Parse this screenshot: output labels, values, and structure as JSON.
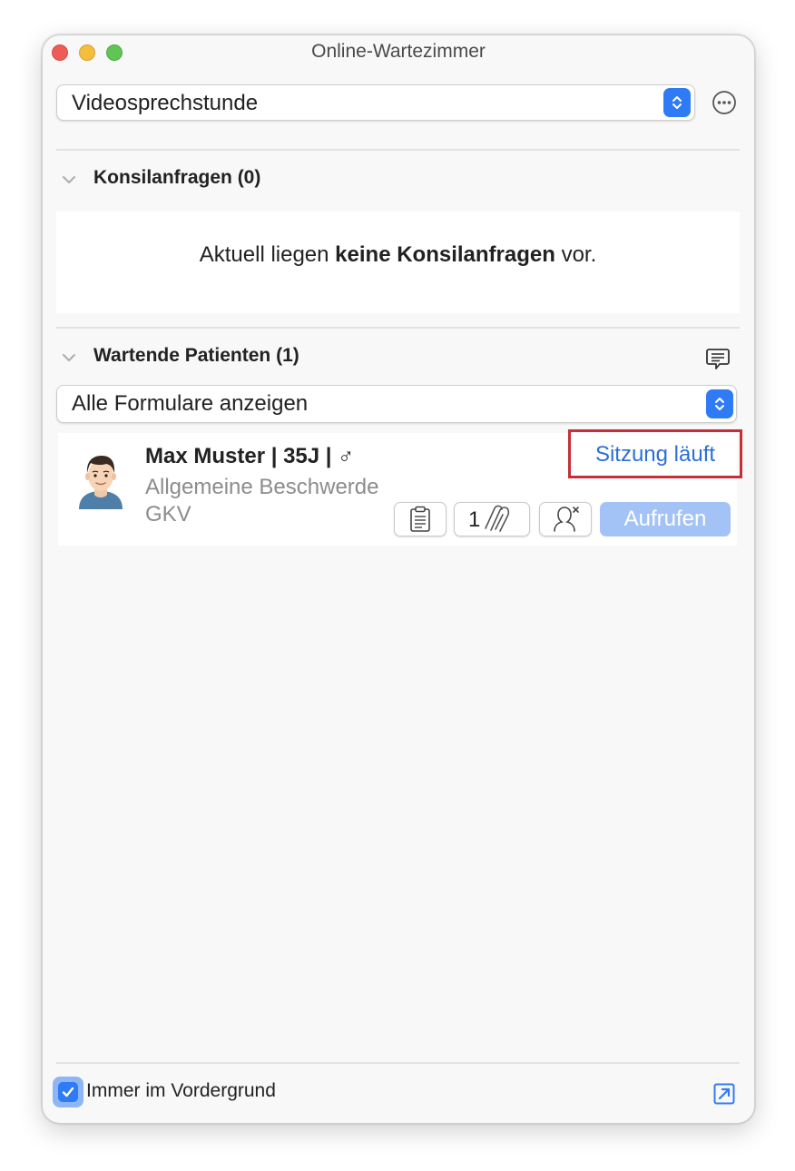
{
  "window": {
    "title": "Online-Wartezimmer"
  },
  "consultation_select": {
    "value": "Videosprechstunde"
  },
  "konsil": {
    "title": "Konsilanfragen (0)",
    "message_before": "Aktuell liegen ",
    "message_bold": "keine Konsilanfragen",
    "message_after": " vor."
  },
  "waiting": {
    "title": "Wartende Patienten (1)",
    "filter_value": "Alle Formulare anzeigen"
  },
  "patient": {
    "name": "Max Muster | 35J | ♂",
    "complaint": "Allgemeine Beschwerde",
    "insurance": "GKV",
    "status_link": "Sitzung läuft",
    "attachment_count": "1",
    "call_button": "Aufrufen"
  },
  "footer": {
    "always_on_top_label": "Immer im Vordergrund",
    "always_on_top_checked": true
  },
  "colors": {
    "accent": "#2f7bf6",
    "link": "#2c6fd6",
    "highlight_border": "#c62f35",
    "call_button_disabled": "#a3c3f6"
  },
  "icons": {
    "more": "ellipsis-circle-icon",
    "chat": "chat-bubble-icon",
    "form": "clipboard-icon",
    "attachment": "paperclip-icon",
    "dismiss": "remove-person-icon",
    "popout": "popout-arrow-icon"
  }
}
